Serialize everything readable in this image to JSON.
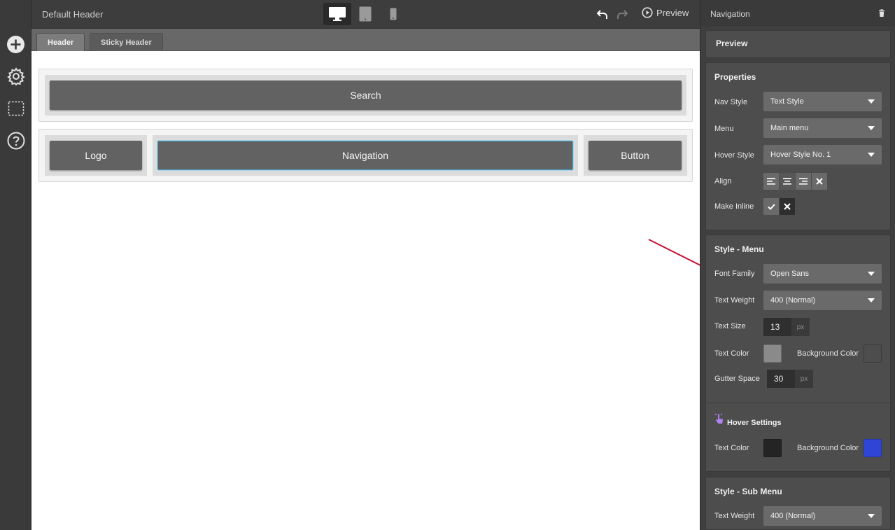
{
  "topbar": {
    "doc_title": "Default Header",
    "preview_label": "Preview"
  },
  "tabs": [
    {
      "label": "Header",
      "active": true
    },
    {
      "label": "Sticky Header",
      "active": false
    }
  ],
  "canvas": {
    "row1": {
      "search_label": "Search"
    },
    "row2": {
      "logo_label": "Logo",
      "nav_label": "Navigation",
      "button_label": "Button"
    }
  },
  "panel": {
    "title": "Navigation",
    "preview_label": "Preview",
    "properties": {
      "title": "Properties",
      "nav_style_label": "Nav Style",
      "nav_style_value": "Text Style",
      "menu_label": "Menu",
      "menu_value": "Main menu",
      "hover_style_label": "Hover Style",
      "hover_style_value": "Hover Style No. 1",
      "align_label": "Align",
      "make_inline_label": "Make Inline"
    },
    "style_menu": {
      "title": "Style - Menu",
      "font_family_label": "Font Family",
      "font_family_value": "Open Sans",
      "text_weight_label": "Text Weight",
      "text_weight_value": "400 (Normal)",
      "text_size_label": "Text Size",
      "text_size_value": "13",
      "text_size_unit": "px",
      "text_color_label": "Text Color",
      "text_color": "#8a8a8a",
      "bg_color_label": "Background Color",
      "bg_color": "#4d4d4d",
      "gutter_label": "Gutter Space",
      "gutter_value": "30",
      "gutter_unit": "px"
    },
    "hover_settings": {
      "title": "Hover Settings",
      "text_color_label": "Text Color",
      "text_color": "#242424",
      "bg_color_label": "Background Color",
      "bg_color": "#2f45d6"
    },
    "style_submenu": {
      "title": "Style - Sub Menu",
      "text_weight_label": "Text Weight",
      "text_weight_value": "400 (Normal)"
    }
  },
  "colors": {
    "accent_arrow": "#c8102e",
    "selection": "#4ba3c7",
    "hover_icon": "#b084f0"
  }
}
